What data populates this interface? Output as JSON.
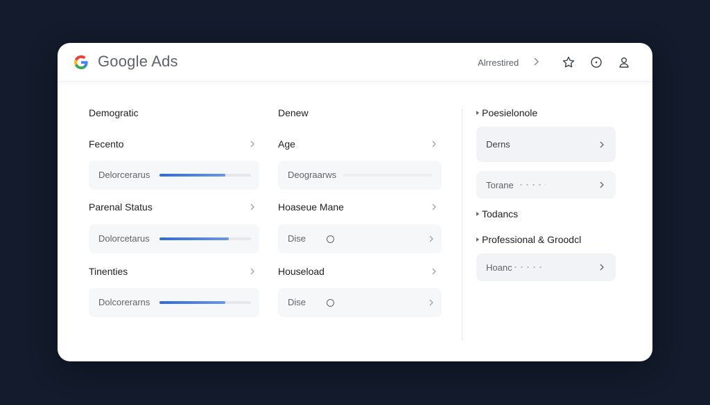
{
  "header": {
    "brand": "Google Ads",
    "breadcrumb": "Alrrestired",
    "icons": [
      "star-icon",
      "info-icon",
      "account-icon"
    ]
  },
  "colors": {
    "background": "#131b2c",
    "accent": "#2d6bdc",
    "field_bg": "#f6f7f9"
  },
  "col1": {
    "title": "Demogratic",
    "rows": [
      {
        "label": "Fecento",
        "field": "Delorcerarus",
        "progress": 0.72
      },
      {
        "label": "Parenal Status",
        "field": "Dolorcetarus",
        "progress": 0.76
      },
      {
        "label": "Tinenties",
        "field": "Dolcorerarns",
        "progress": 0.72
      }
    ]
  },
  "col2": {
    "title": "Denew",
    "rows": [
      {
        "label": "Age",
        "field": "Deograarws"
      },
      {
        "label": "Hoaseue Mane",
        "field": "Dise"
      },
      {
        "label": "Houseload",
        "field": "Dise"
      }
    ]
  },
  "right": {
    "section1": "Poesielonole",
    "card1": "Derns",
    "card2": "Torane",
    "section2": "Todancs",
    "section3": "Professional & Groodcl",
    "card3": "Hoanc"
  }
}
